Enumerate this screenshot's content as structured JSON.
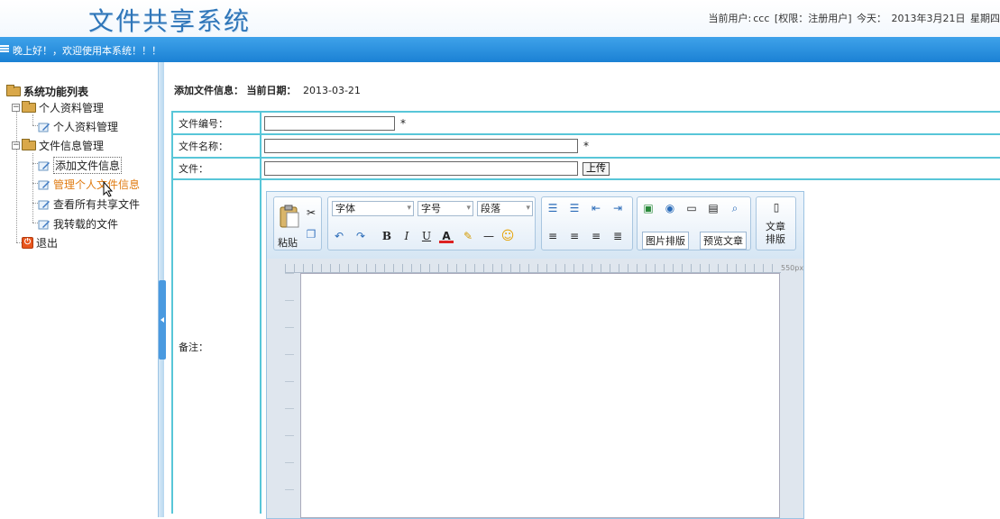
{
  "header": {
    "logo": "文件共享系统",
    "user_label": "当前用户:",
    "user_name": "ccc",
    "role": "[权限：注册用户]",
    "today_label": "今天：",
    "today_date": "2013年3月21日",
    "weekday": "星期四"
  },
  "bluebar": {
    "greeting": "晚上好！，欢迎使用本系统！！！"
  },
  "sidebar": {
    "root": "系统功能列表",
    "groups": [
      {
        "label": "个人资料管理",
        "items": [
          "个人资料管理"
        ]
      },
      {
        "label": "文件信息管理",
        "items": [
          "添加文件信息",
          "管理个人文件信息",
          "查看所有共享文件",
          "我转载的文件"
        ]
      }
    ],
    "exit": "退出",
    "active_item": "管理个人文件信息"
  },
  "main": {
    "crumb_title": "添加文件信息：",
    "date_label": "当前日期：",
    "date_value": "2013-03-21",
    "form": {
      "file_no_label": "文件编号：",
      "file_no_value": "",
      "file_name_label": "文件名称：",
      "file_name_value": "",
      "file_label": "文件：",
      "file_value": "",
      "upload_label": "上传",
      "required_mark": "*",
      "notes_label": "备注："
    },
    "editor": {
      "paste": "粘贴",
      "font": "字体",
      "size": "字号",
      "paragraph": "段落",
      "image_layout": "图片排版",
      "preview": "预览文章",
      "article_layout": "文章排版",
      "article_layout_line2": "排版",
      "article_layout_line1": "文章",
      "ruler_label": "550px"
    }
  },
  "colors": {
    "accent": "#1b81d4",
    "border": "#58c6d8",
    "active_link": "#e07b11"
  }
}
